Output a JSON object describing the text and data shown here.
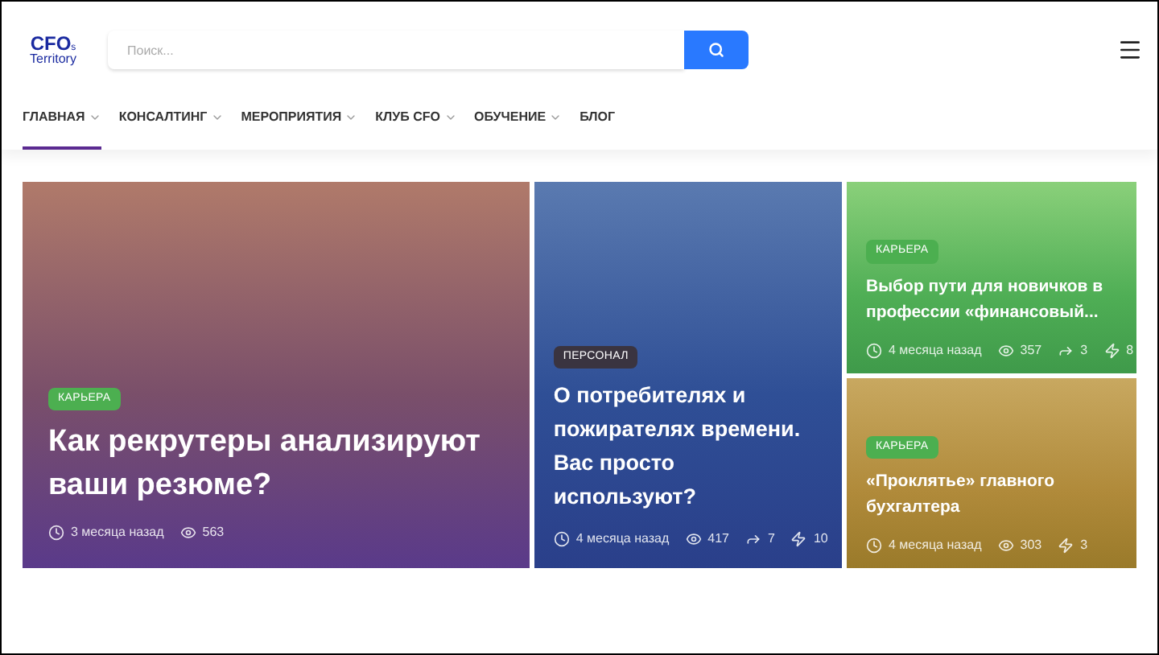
{
  "header": {
    "logo": {
      "title": "CFO",
      "subscript": "s",
      "subtitle": "Territory"
    },
    "search": {
      "placeholder": "Поиск..."
    }
  },
  "nav": [
    {
      "label": "ГЛАВНАЯ",
      "dropdown": true,
      "selected": true
    },
    {
      "label": "КОНСАЛТИНГ",
      "dropdown": true,
      "selected": false
    },
    {
      "label": "МЕРОПРИЯТИЯ",
      "dropdown": true,
      "selected": false
    },
    {
      "label": "КЛУБ CFO",
      "dropdown": true,
      "selected": false
    },
    {
      "label": "ОБУЧЕНИЕ",
      "dropdown": true,
      "selected": false
    },
    {
      "label": "БЛОГ",
      "dropdown": false,
      "selected": false
    }
  ],
  "posts": [
    {
      "kind": "large",
      "category": "КАРЬЕРА",
      "color": "#4caf50",
      "title": "Как рекрутеры анализируют ваши резюме?",
      "meta": [
        {
          "kind": "time",
          "text": "3 месяца назад"
        },
        {
          "kind": "views",
          "text": "563"
        }
      ]
    },
    {
      "kind": "medium",
      "category": "ПЕРСОНАЛ",
      "color": "#3a3440",
      "title": "О потребителях и пожирателях времени. Вас просто используют?",
      "meta": [
        {
          "kind": "time",
          "text": "4 месяца назад"
        },
        {
          "kind": "views",
          "text": "417"
        },
        {
          "kind": "shares",
          "text": "7"
        },
        {
          "kind": "hits",
          "text": "10"
        }
      ]
    },
    {
      "kind": "small",
      "category": "КАРЬЕРА",
      "color": "#4caf50",
      "title": "Выбор пути для новичков в профессии «финансовый...",
      "meta": [
        {
          "kind": "time",
          "text": "4 месяца назад"
        },
        {
          "kind": "views",
          "text": "357"
        },
        {
          "kind": "shares",
          "text": "3"
        },
        {
          "kind": "hits",
          "text": "8"
        }
      ]
    },
    {
      "kind": "small",
      "category": "КАРЬЕРА",
      "color": "#4caf50",
      "title": "«Проклятье» главного бухгалтера",
      "meta": [
        {
          "kind": "time",
          "text": "4 месяца назад"
        },
        {
          "kind": "views",
          "text": "303"
        },
        {
          "kind": "hits",
          "text": "3"
        }
      ]
    }
  ]
}
